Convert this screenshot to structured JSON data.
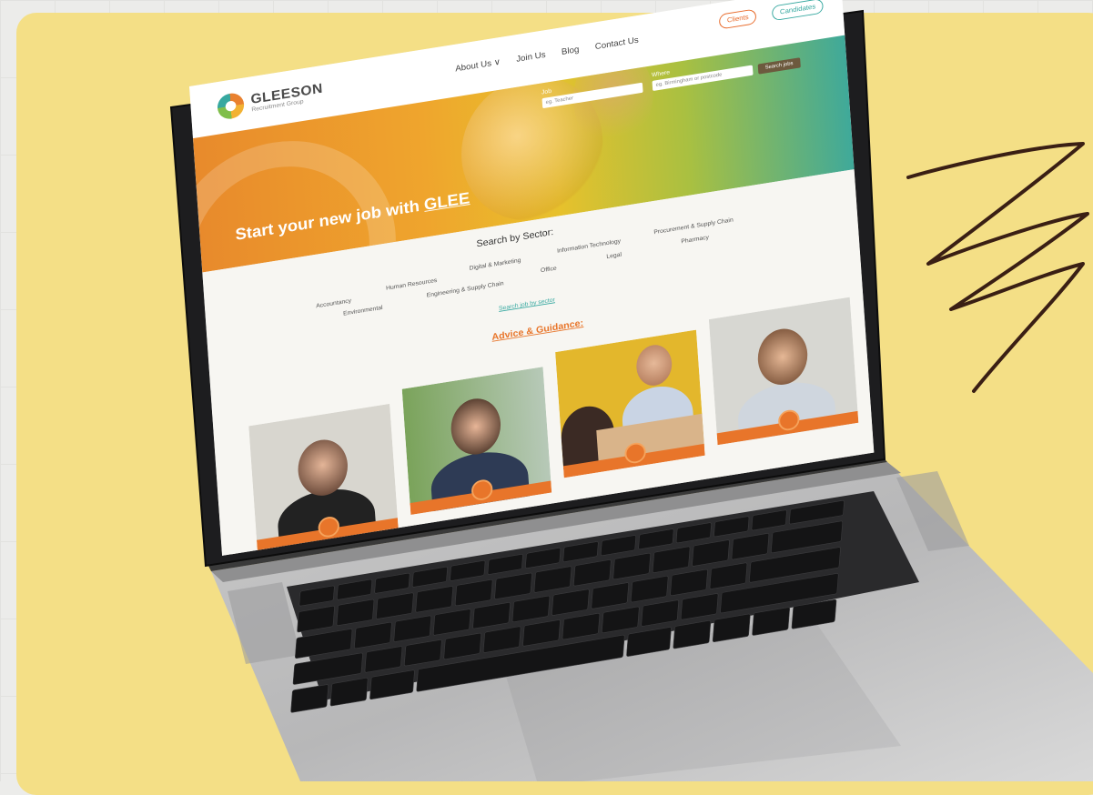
{
  "site": {
    "logo": {
      "name": "GLEESON",
      "subtitle": "Recruitment Group"
    },
    "nav": [
      {
        "label": "About Us ∨"
      },
      {
        "label": "Join Us"
      },
      {
        "label": "Blog"
      },
      {
        "label": "Contact Us"
      }
    ],
    "buttons": {
      "clients": "Clients",
      "candidates": "Candidates"
    },
    "hero": {
      "title_prefix": "Start your new job with ",
      "title_highlight": "GLEE",
      "job_label": "Job",
      "job_placeholder": "eg. Teacher",
      "where_label": "Where",
      "where_placeholder": "eg. Birmingham or postcode",
      "search_button": "Search jobs"
    },
    "sectors": {
      "title": "Search by Sector:",
      "items": [
        "Accountancy",
        "Human Resources",
        "Digital & Marketing",
        "Information Technology",
        "Procurement & Supply Chain",
        "Environmental",
        "Engineering & Supply Chain",
        "Office",
        "Legal",
        "Pharmacy"
      ],
      "link": "Search job by sector"
    },
    "advice": {
      "title": "Advice & Guidance:"
    }
  },
  "colors": {
    "background_card": "#f4df86",
    "accent_orange": "#e8752a",
    "accent_teal": "#36a8a0",
    "scribble": "#3a1f14"
  }
}
